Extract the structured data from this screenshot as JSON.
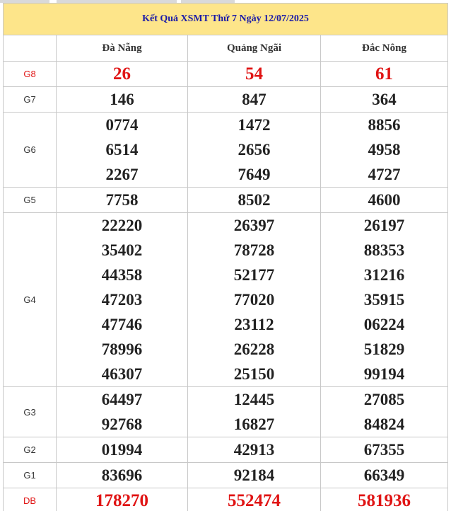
{
  "title": "Kết Quả XSMT Thứ 7 Ngày 12/07/2025",
  "provinces": [
    "Đà Nẵng",
    "Quảng Ngãi",
    "Đắc Nông"
  ],
  "prizes": [
    {
      "label": "G8",
      "values": [
        [
          "26"
        ],
        [
          "54"
        ],
        [
          "61"
        ]
      ]
    },
    {
      "label": "G7",
      "values": [
        [
          "146"
        ],
        [
          "847"
        ],
        [
          "364"
        ]
      ]
    },
    {
      "label": "G6",
      "values": [
        [
          "0774",
          "6514",
          "2267"
        ],
        [
          "1472",
          "2656",
          "7649"
        ],
        [
          "8856",
          "4958",
          "4727"
        ]
      ]
    },
    {
      "label": "G5",
      "values": [
        [
          "7758"
        ],
        [
          "8502"
        ],
        [
          "4600"
        ]
      ]
    },
    {
      "label": "G4",
      "values": [
        [
          "22220",
          "35402",
          "44358",
          "47203",
          "47746",
          "78996",
          "46307"
        ],
        [
          "26397",
          "78728",
          "52177",
          "77020",
          "23112",
          "26228",
          "25150"
        ],
        [
          "26197",
          "88353",
          "31216",
          "35915",
          "06224",
          "51829",
          "99194"
        ]
      ]
    },
    {
      "label": "G3",
      "values": [
        [
          "64497",
          "92768"
        ],
        [
          "12445",
          "16827"
        ],
        [
          "27085",
          "84824"
        ]
      ]
    },
    {
      "label": "G2",
      "values": [
        [
          "01994"
        ],
        [
          "42913"
        ],
        [
          "67355"
        ]
      ]
    },
    {
      "label": "G1",
      "values": [
        [
          "83696"
        ],
        [
          "92184"
        ],
        [
          "66349"
        ]
      ]
    },
    {
      "label": "DB",
      "values": [
        [
          "178270"
        ],
        [
          "552474"
        ],
        [
          "581936"
        ]
      ]
    }
  ],
  "colors": {
    "header_bg": "#fde58a",
    "header_text": "#1a1aa8",
    "highlight": "#e01414"
  }
}
